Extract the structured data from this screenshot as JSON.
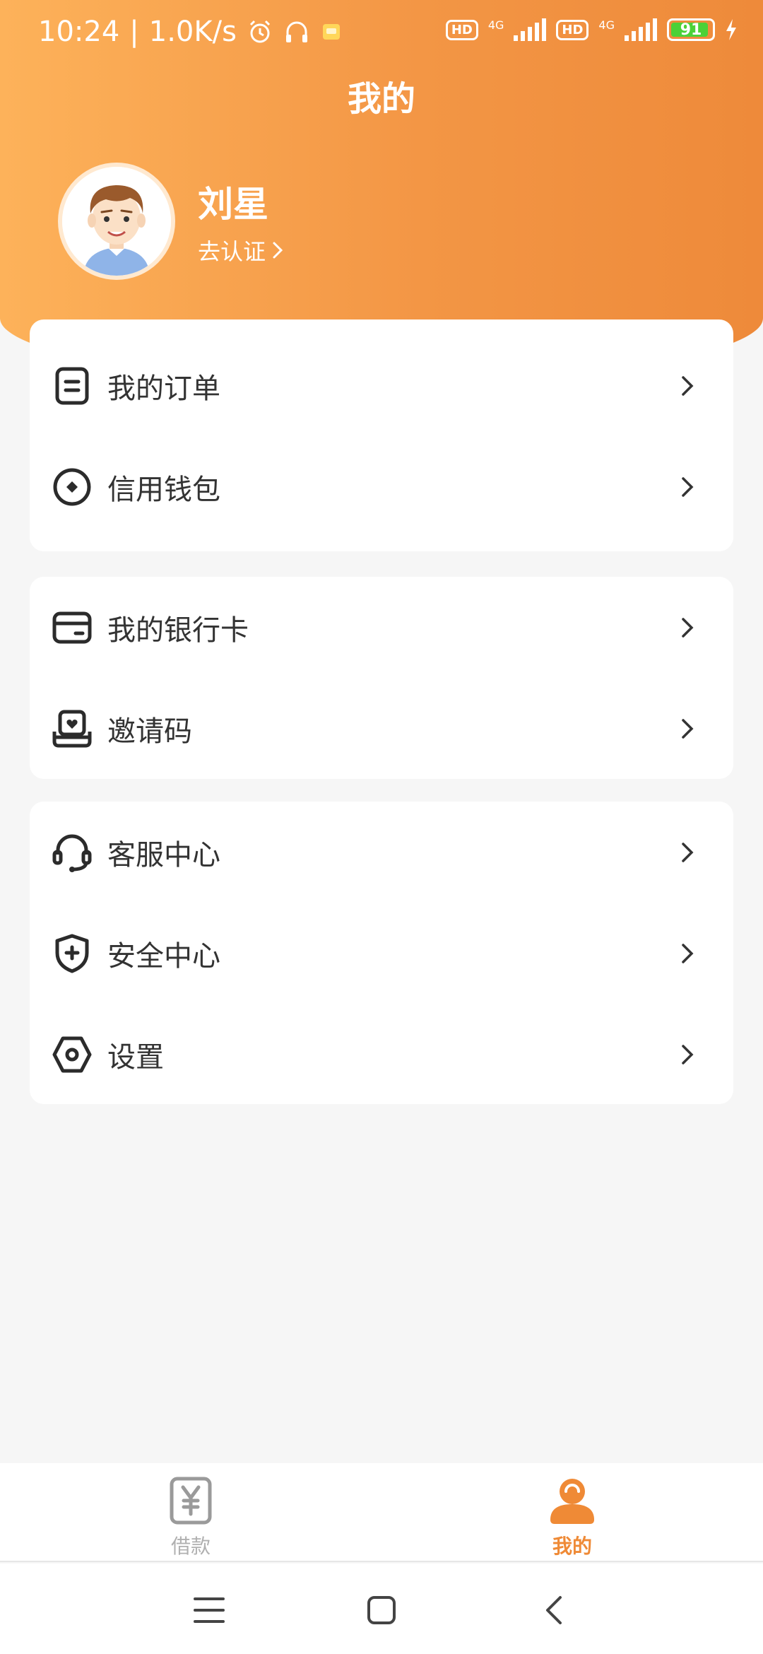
{
  "status": {
    "time": "10:24",
    "speed": "1.0K/s",
    "hd1": "HD",
    "net1": "4G",
    "hd2": "HD",
    "net2": "4G",
    "battery": "91"
  },
  "header": {
    "title": "我的"
  },
  "profile": {
    "name": "刘星",
    "verify_label": "去认证"
  },
  "menu": {
    "group1": [
      {
        "label": "我的订单",
        "icon": "order-icon"
      },
      {
        "label": "信用钱包",
        "icon": "wallet-icon"
      }
    ],
    "group2": [
      {
        "label": "我的银行卡",
        "icon": "bank-card-icon"
      },
      {
        "label": "邀请码",
        "icon": "invite-icon"
      }
    ],
    "group3": [
      {
        "label": "客服中心",
        "icon": "headset-icon"
      },
      {
        "label": "安全中心",
        "icon": "shield-icon"
      },
      {
        "label": "设置",
        "icon": "settings-icon"
      }
    ]
  },
  "tabbar": {
    "loan": {
      "label": "借款",
      "icon": "yen-icon"
    },
    "mine": {
      "label": "我的",
      "icon": "user-icon",
      "active": true
    }
  },
  "colors": {
    "accent": "#ef8a36",
    "header_start": "#fdb25a",
    "header_end": "#ee8a3a"
  }
}
